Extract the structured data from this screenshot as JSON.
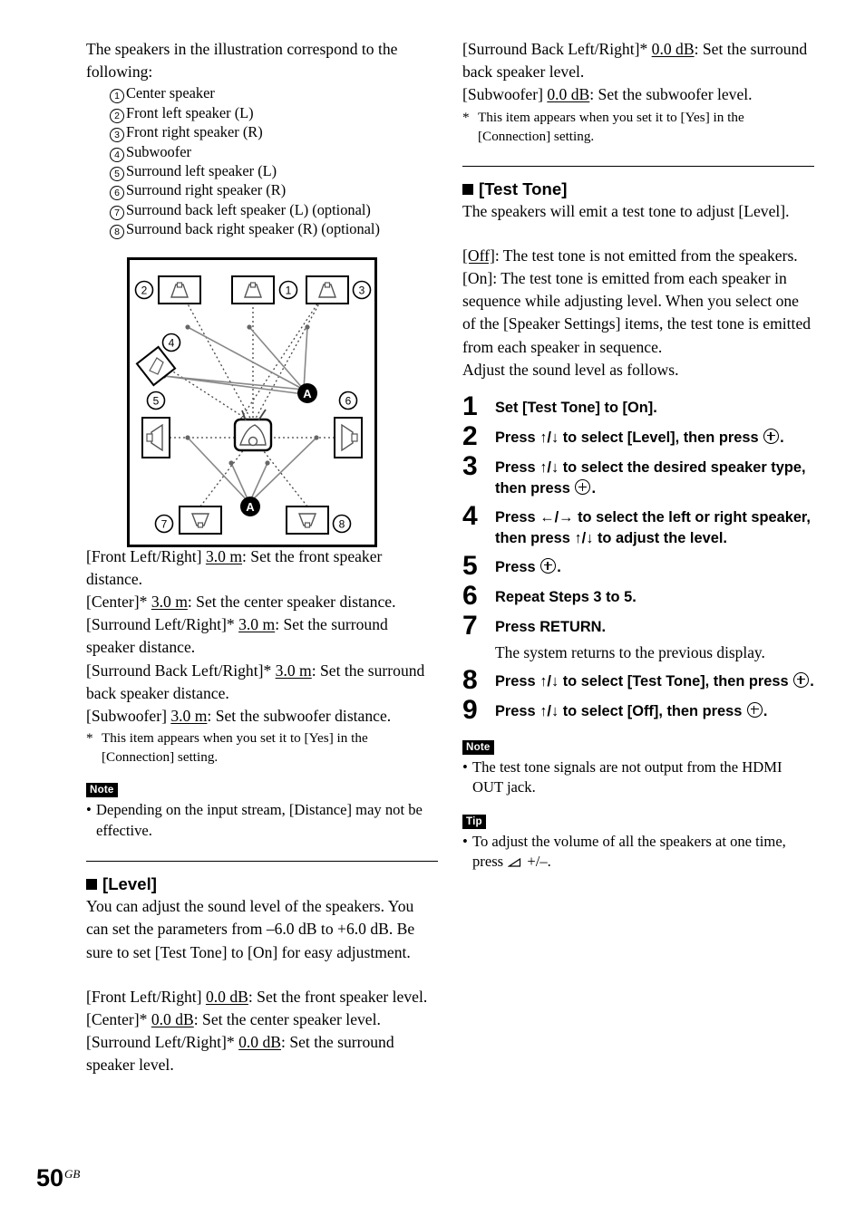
{
  "page": {
    "number": "50",
    "region_code": "GB"
  },
  "left_column": {
    "intro": "The speakers in the illustration correspond to the following:",
    "speaker_list": [
      {
        "num": "1",
        "label": "Center speaker"
      },
      {
        "num": "2",
        "label": "Front left speaker (L)"
      },
      {
        "num": "3",
        "label": "Front right speaker (R)"
      },
      {
        "num": "4",
        "label": "Subwoofer"
      },
      {
        "num": "5",
        "label": "Surround left speaker (L)"
      },
      {
        "num": "6",
        "label": "Surround right speaker (R)"
      },
      {
        "num": "7",
        "label": "Surround back left speaker (L) (optional)"
      },
      {
        "num": "8",
        "label": "Surround back right speaker (R) (optional)"
      }
    ],
    "diagram": {
      "callouts": [
        "1",
        "2",
        "3",
        "4",
        "5",
        "6",
        "7",
        "8"
      ],
      "listening_position_label": "A"
    },
    "distance_settings": [
      {
        "pre": "[Front Left/Right] ",
        "value": "3.0 m",
        "post": ": Set the front speaker distance."
      },
      {
        "pre": "[Center]* ",
        "value": "3.0 m",
        "post": ": Set the center speaker distance."
      },
      {
        "pre": "[Surround Left/Right]* ",
        "value": "3.0 m",
        "post": ": Set the surround speaker distance."
      },
      {
        "pre": "[Surround Back Left/Right]* ",
        "value": "3.0 m",
        "post": ": Set the surround back speaker distance."
      },
      {
        "pre": "[Subwoofer] ",
        "value": "3.0 m",
        "post": ": Set the subwoofer distance."
      }
    ],
    "distance_footnote": {
      "star": "*",
      "text": "This item appears when you set it to [Yes] in the [Connection] setting."
    },
    "distance_note": {
      "badge": "Note",
      "bullet": "•",
      "text": "Depending on the input stream, [Distance] may not be effective."
    },
    "level_section": {
      "heading": "[Level]",
      "paragraph": "You can adjust the sound level of the speakers. You can set the parameters from –6.0 dB to +6.0 dB. Be sure to set [Test Tone] to [On] for easy adjustment.",
      "settings": [
        {
          "pre": "[Front Left/Right] ",
          "value": "0.0 dB",
          "post": ": Set the front speaker level."
        },
        {
          "pre": "[Center]* ",
          "value": "0.0 dB",
          "post": ": Set the center speaker level."
        },
        {
          "pre": "[Surround Left/Right]* ",
          "value": "0.0 dB",
          "post": ": Set the surround speaker level."
        }
      ]
    }
  },
  "right_column": {
    "level_settings_continued": [
      {
        "pre": "[Surround Back Left/Right]* ",
        "value": "0.0 dB",
        "post": ": Set the surround back speaker level."
      },
      {
        "pre": "[Subwoofer] ",
        "value": "0.0 dB",
        "post": ": Set the subwoofer level."
      }
    ],
    "level_footnote": {
      "star": "*",
      "text": "This item appears when you set it to [Yes] in the [Connection] setting."
    },
    "test_tone_section": {
      "heading": "[Test Tone]",
      "intro": "The speakers will emit a test tone to adjust [Level].",
      "option_off": {
        "value": "[Off]",
        "text": ": The test tone is not emitted from the speakers."
      },
      "option_on": {
        "value": "[On]",
        "text": ": The test tone is emitted from each speaker in sequence while adjusting level. When you select one of the [Speaker Settings] items, the test tone is emitted from each speaker in sequence."
      },
      "adjust_lead": "Adjust the sound level as follows."
    },
    "steps": [
      {
        "num": "1",
        "parts": [
          {
            "t": "text",
            "v": "Set [Test Tone] to [On]."
          }
        ]
      },
      {
        "num": "2",
        "parts": [
          {
            "t": "text",
            "v": "Press ↑/↓ to select [Level], then press "
          },
          {
            "t": "icon",
            "v": "enter-icon"
          },
          {
            "t": "text",
            "v": "."
          }
        ]
      },
      {
        "num": "3",
        "parts": [
          {
            "t": "text",
            "v": "Press ↑/↓ to select the desired speaker type, then press "
          },
          {
            "t": "icon",
            "v": "enter-icon"
          },
          {
            "t": "text",
            "v": "."
          }
        ]
      },
      {
        "num": "4",
        "parts": [
          {
            "t": "text",
            "v": "Press ←/→ to select the left or right speaker, then press ↑/↓ to adjust the level."
          }
        ]
      },
      {
        "num": "5",
        "parts": [
          {
            "t": "text",
            "v": "Press "
          },
          {
            "t": "icon",
            "v": "enter-icon"
          },
          {
            "t": "text",
            "v": "."
          }
        ]
      },
      {
        "num": "6",
        "parts": [
          {
            "t": "text",
            "v": "Repeat Steps 3 to 5."
          }
        ]
      },
      {
        "num": "7",
        "parts": [
          {
            "t": "text",
            "v": "Press RETURN."
          }
        ],
        "sub": "The system returns to the previous display."
      },
      {
        "num": "8",
        "parts": [
          {
            "t": "text",
            "v": "Press ↑/↓ to select [Test Tone], then press "
          },
          {
            "t": "icon",
            "v": "enter-icon"
          },
          {
            "t": "text",
            "v": "."
          }
        ]
      },
      {
        "num": "9",
        "parts": [
          {
            "t": "text",
            "v": "Press ↑/↓ to select [Off], then press "
          },
          {
            "t": "icon",
            "v": "enter-icon"
          },
          {
            "t": "text",
            "v": "."
          }
        ]
      }
    ],
    "note_box": {
      "badge": "Note",
      "bullet": "•",
      "text": "The test tone signals are not output from the HDMI OUT jack."
    },
    "tip_box": {
      "badge": "Tip",
      "bullet": "•",
      "text_before": "To adjust the volume of all the speakers at one time, press ",
      "icon": "volume-icon",
      "text_after": " +/–."
    }
  }
}
